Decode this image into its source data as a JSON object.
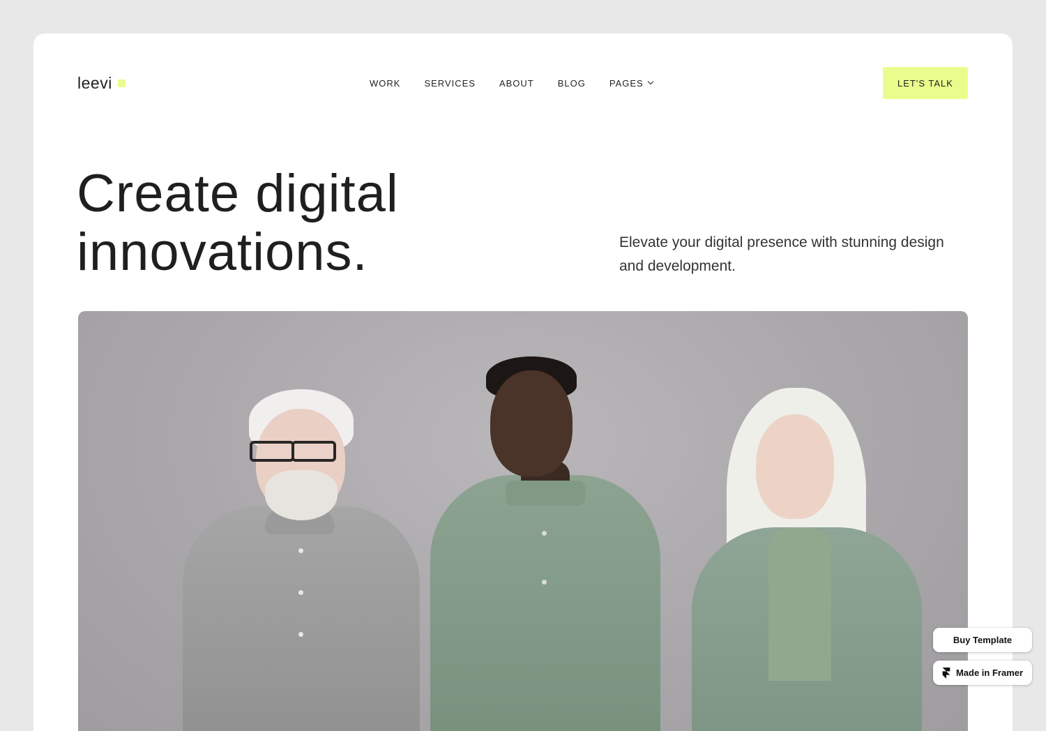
{
  "header": {
    "logo_text": "leevi",
    "nav": [
      {
        "label": "WORK"
      },
      {
        "label": "SERVICES"
      },
      {
        "label": "ABOUT"
      },
      {
        "label": "BLOG"
      },
      {
        "label": "PAGES",
        "has_dropdown": true
      }
    ],
    "cta_label": "LET'S TALK"
  },
  "hero": {
    "title_line1": "Create digital",
    "title_line2": "innovations.",
    "subtitle": "Elevate your digital presence with stunning design and development."
  },
  "badges": {
    "buy_template": "Buy Template",
    "made_in_framer": "Made in Framer"
  },
  "colors": {
    "accent": "#eafd8c",
    "page_background": "#e8e8e8",
    "card_background": "#ffffff",
    "text": "#1f1f1f"
  },
  "icons": [
    "logo-square-icon",
    "chevron-down-icon",
    "framer-logo-icon"
  ]
}
